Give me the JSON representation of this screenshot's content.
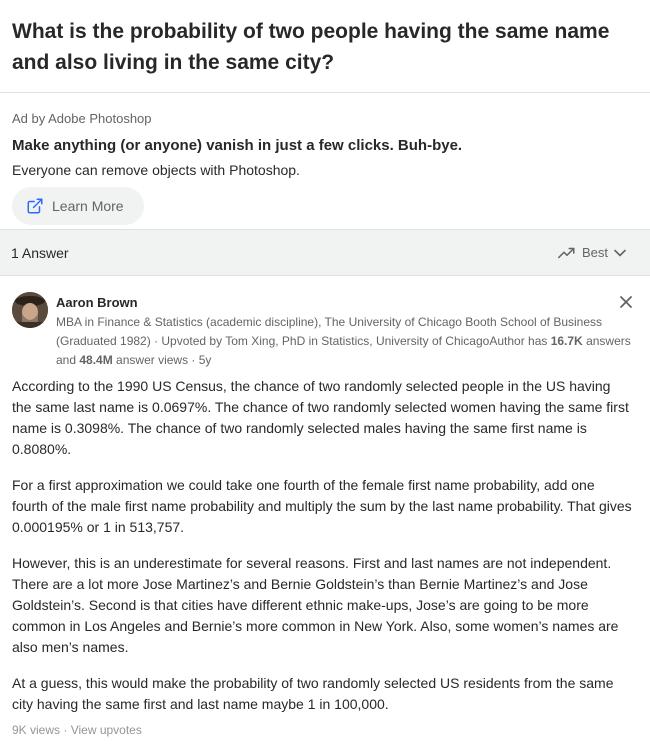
{
  "question": {
    "title": "What is the probability of two people having the same name and also living in the same city?"
  },
  "ad": {
    "label": "Ad by Adobe Photoshop",
    "headline": "Make anything (or anyone) vanish in just a few clicks. Buh-bye.",
    "text": "Everyone can remove objects with Photoshop.",
    "cta_label": "Learn More",
    "cta_icon": "external-link-icon"
  },
  "answers_bar": {
    "count_label": "1 Answer",
    "sort_label": "Best",
    "sort_icon": "trending-icon"
  },
  "answer": {
    "author": "Aaron Brown",
    "credentials_prefix": "MBA in Finance & Statistics (academic discipline), The University of Chicago Booth School of Business (Graduated 1982) · Upvoted by ",
    "upvoter": "Tom Xing, PhD in Statistics, University of Chicago",
    "author_suffix": "Author has ",
    "answers_count": "16.7K",
    "answers_word": " answers and ",
    "views_count": "48.4M",
    "views_word": " answer views · 5y",
    "paragraphs": [
      "According to the 1990 US Census, the chance of two randomly selected people in the US having the same last name is 0.0697%. The chance of two randomly selected women having the same first name is 0.3098%. The chance of two randomly selected males having the same first name is 0.8080%.",
      "For a first approximation we could take one fourth of the female first name probability, add one fourth of the male first name probability and multiply the sum by the last name probability. That gives 0.000195% or 1 in 513,757.",
      "However, this is an underestimate for several reasons. First and last names are not independent. There are a lot more Jose Martinez’s and Bernie Goldstein’s than Bernie Martinez’s and Jose Goldstein’s. Second is that cities have different ethnic make-ups, Jose’s are going to be more common in Los Angeles and Bernie’s more common in New York. Also, some women’s names are also men’s names.",
      "At a guess, this would make the probability of two randomly selected US residents from the same city having the same first and last name maybe 1 in 100,000."
    ],
    "views_footer": "9K views",
    "footer_sep": " · ",
    "upvotes_link": "View upvotes"
  },
  "colors": {
    "text_primary": "#282829",
    "text_secondary": "#636466",
    "text_muted": "#939598",
    "bar_bg": "#f1f2f2",
    "divider": "#dee0e1"
  }
}
